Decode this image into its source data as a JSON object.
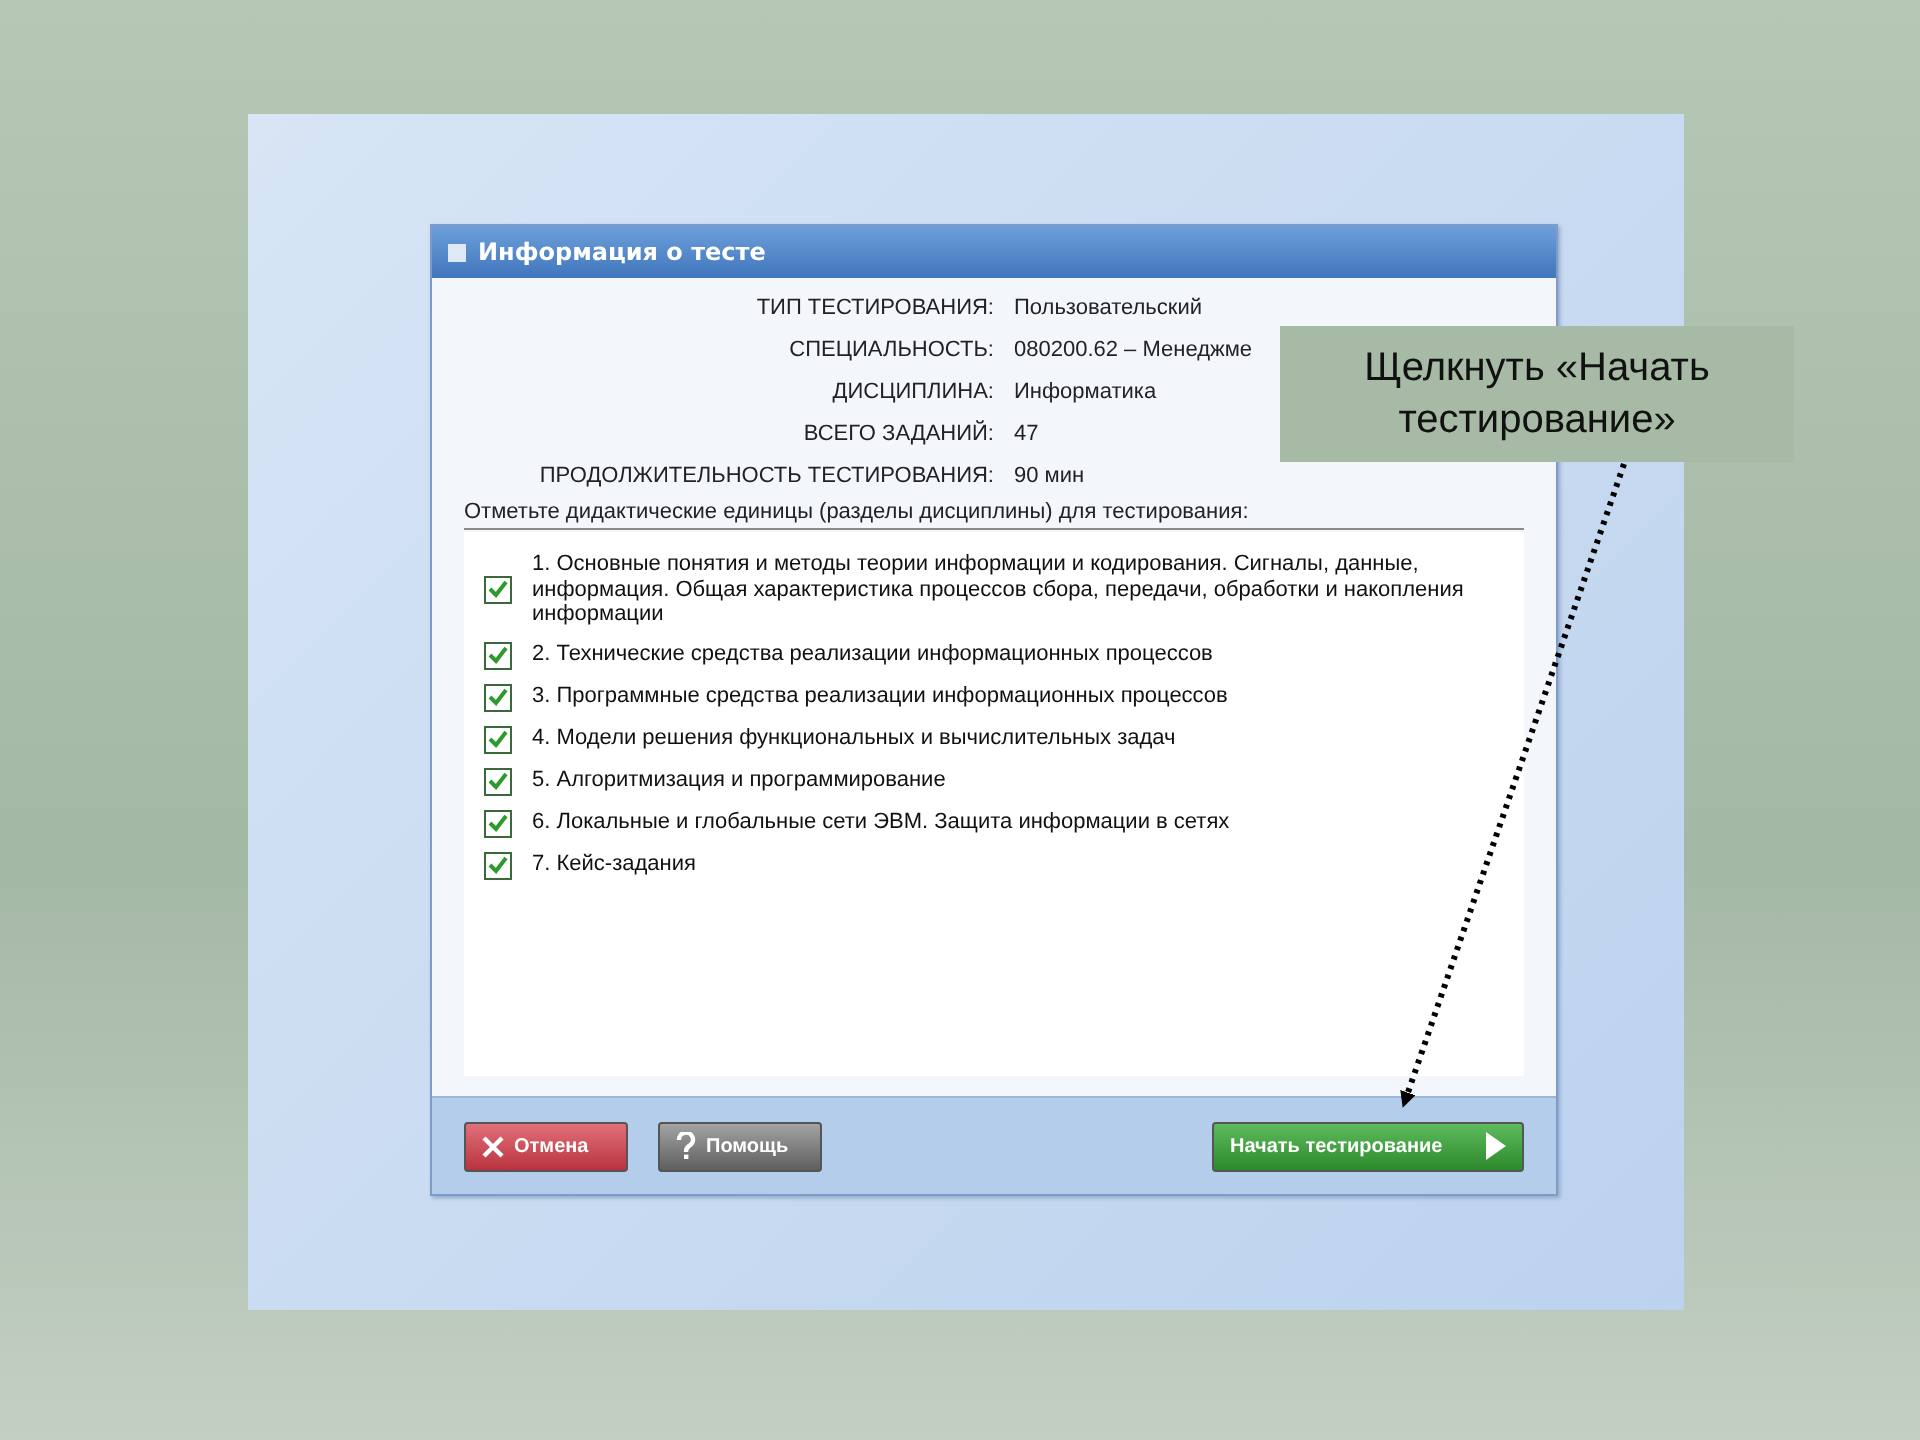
{
  "dialog": {
    "title": "Информация о тесте",
    "info": [
      {
        "label": "ТИП ТЕСТИРОВАНИЯ:",
        "value": "Пользовательский"
      },
      {
        "label": "СПЕЦИАЛЬНОСТЬ:",
        "value": "080200.62 – Менеджме"
      },
      {
        "label": "ДИСЦИПЛИНА:",
        "value": "Информатика"
      },
      {
        "label": "ВСЕГО ЗАДАНИЙ:",
        "value": "47"
      },
      {
        "label": "ПРОДОЛЖИТЕЛЬНОСТЬ ТЕСТИРОВАНИЯ:",
        "value": "90 мин"
      }
    ],
    "instruction": "Отметьте дидактические единицы (разделы дисциплины) для тестирования:",
    "sections": [
      {
        "text": "1. Основные понятия и методы теории информации и кодирования. Сигналы, данные, информация. Общая характеристика процессов сбора, передачи, обработки и накопления информации",
        "checked": true
      },
      {
        "text": "2. Технические средства реализации информационных процессов",
        "checked": true
      },
      {
        "text": "3. Программные средства реализации информационных процессов",
        "checked": true
      },
      {
        "text": "4. Модели решения функциональных и вычислительных задач",
        "checked": true
      },
      {
        "text": "5. Алгоритмизация и программирование",
        "checked": true
      },
      {
        "text": "6. Локальные и глобальные сети ЭВМ. Защита информации в сетях",
        "checked": true
      },
      {
        "text": "7. Кейс-задания",
        "checked": true
      }
    ],
    "buttons": [
      {
        "kind": "cancel",
        "label": "Отмена"
      },
      {
        "kind": "help",
        "label": "Помощь"
      },
      {
        "kind": "start",
        "label": "Начать тестирование"
      }
    ]
  },
  "callout": {
    "text": "Щелкнуть «Начать тестирование»"
  }
}
